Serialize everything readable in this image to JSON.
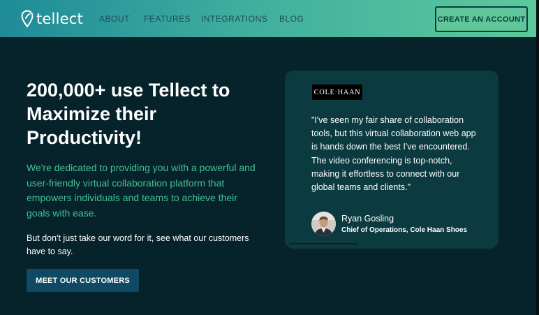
{
  "nav": {
    "logo_text": "tellect",
    "links": [
      "ABOUT",
      "FEATURES",
      "INTEGRATIONS",
      "BLOG"
    ],
    "cta_label": "CREATE AN ACCOUNT"
  },
  "hero": {
    "title": "200,000+ use Tellect to Maximize their Productivity!",
    "intro": "We're dedicated to providing you with a powerful and user-friendly virtual collaboration platform that empowers individuals and teams to achieve their goals with ease.",
    "note": "But don't just take our word for it, see what our customers have to say.",
    "button_label": "MEET OUR CUSTOMERS"
  },
  "testimonial": {
    "brand": "COLE·HAAN",
    "quote": "\"I've seen my fair share of collaboration tools, but this virtual collaboration web app is hands down the best I've encountered. The video conferencing is top-notch, making it effortless to connect with our global teams and clients.\"",
    "author_name": "Ryan Gosling",
    "author_role": "Chief of Operations, Cole Haan Shoes"
  },
  "colors": {
    "background": "#06222a",
    "nav_gradient_start": "#1e8b98",
    "nav_gradient_end": "#5cc99b",
    "accent_green": "#45c096",
    "card_background": "#0b3a40",
    "button_blue": "#0e4a64"
  },
  "icons": {
    "logo": "location-pin-icon"
  }
}
